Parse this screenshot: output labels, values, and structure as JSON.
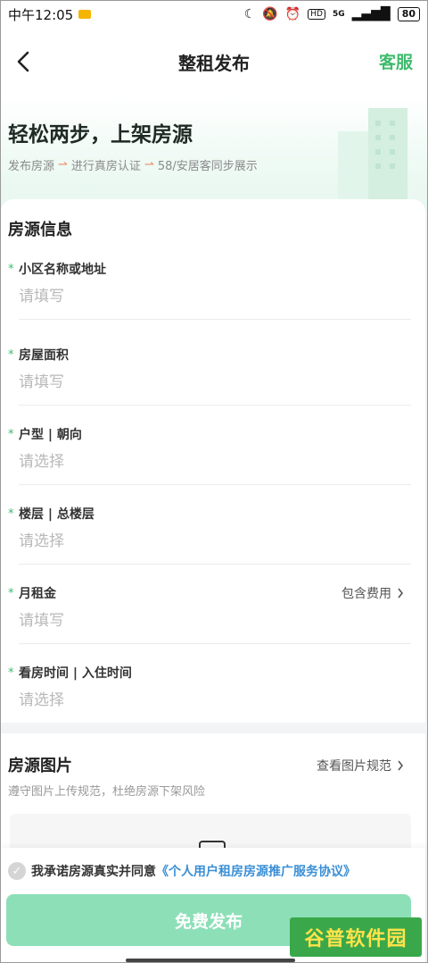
{
  "status_bar": {
    "time": "中午12:05",
    "network": "5G",
    "battery": "80"
  },
  "nav": {
    "title": "整租发布",
    "service": "客服"
  },
  "hero": {
    "title": "轻松两步，上架房源",
    "steps": [
      "发布房源",
      "进行真房认证",
      "58/安居客同步展示"
    ]
  },
  "form": {
    "section_title": "房源信息",
    "fields": [
      {
        "label": "小区名称或地址",
        "placeholder": "请填写"
      },
      {
        "label": "房屋面积",
        "placeholder": "请填写"
      },
      {
        "label": "户型 | 朝向",
        "placeholder": "请选择"
      },
      {
        "label": "楼层 | 总楼层",
        "placeholder": "请选择"
      },
      {
        "label": "月租金",
        "placeholder": "请填写",
        "extra": "包含费用"
      },
      {
        "label": "看房时间 | 入住时间",
        "placeholder": "请选择"
      }
    ]
  },
  "photos": {
    "title": "房源图片",
    "link": "查看图片规范",
    "subtitle": "遵守图片上传规范，杜绝房源下架风险"
  },
  "footer": {
    "agree_text": "我承诺房源真实并同意",
    "agree_link": "《个人用户租房房源推广服务协议》",
    "publish_label": "免费发布"
  },
  "watermark": "谷普软件园",
  "colors": {
    "accent": "#3dbb6c",
    "button": "#8ddfb8",
    "link": "#3a8fd6"
  }
}
